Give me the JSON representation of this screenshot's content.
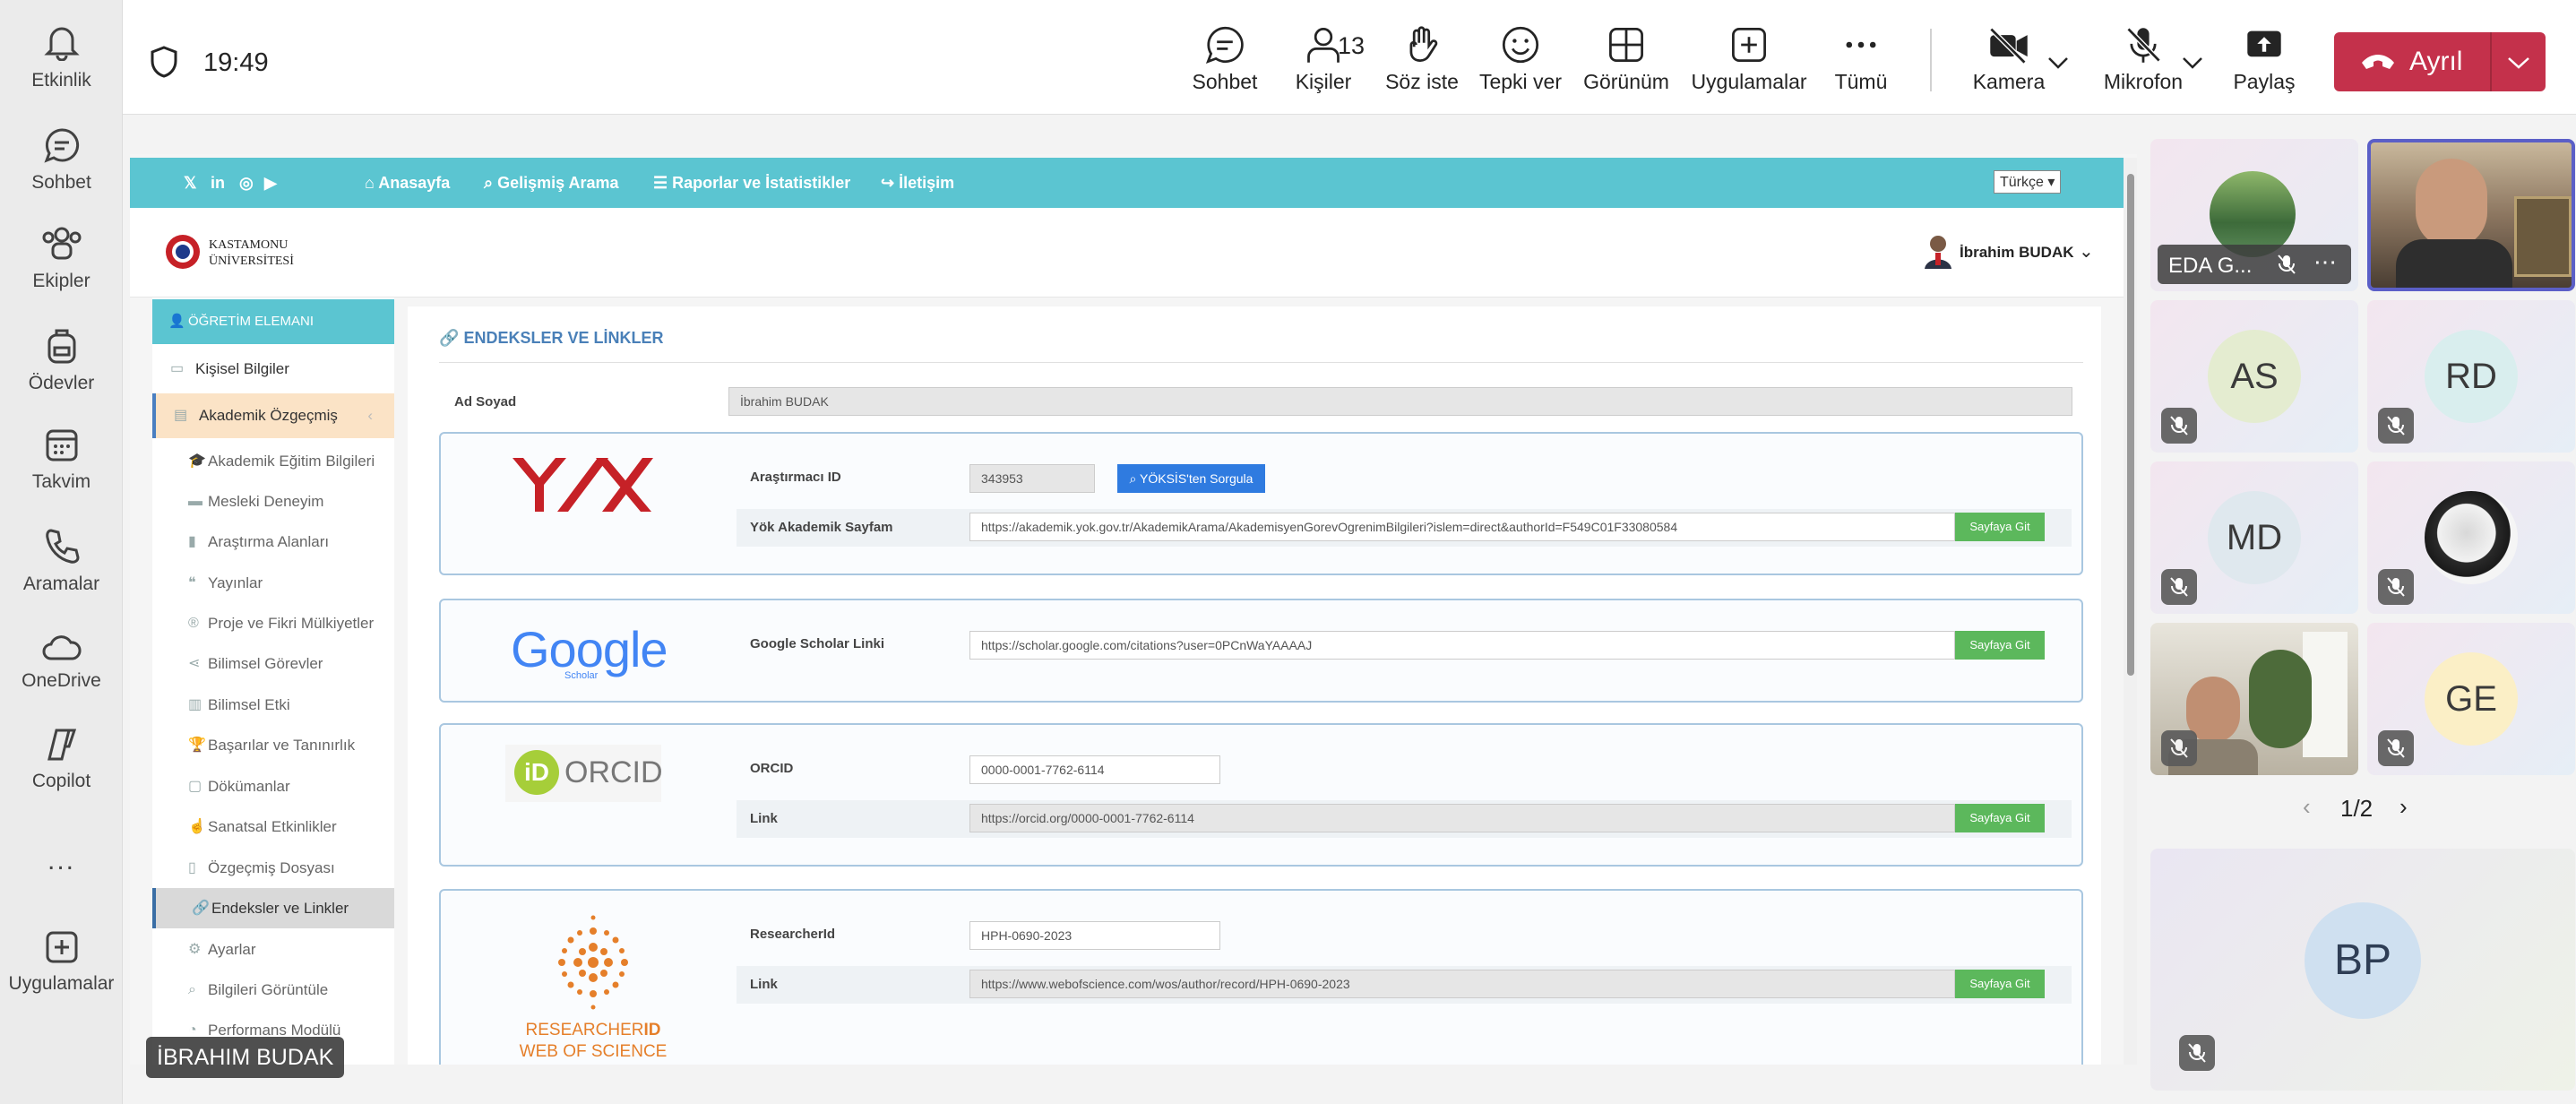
{
  "rail": [
    {
      "label": "Etkinlik",
      "icon": "bell-icon"
    },
    {
      "label": "Sohbet",
      "icon": "chat-icon"
    },
    {
      "label": "Ekipler",
      "icon": "teams-icon"
    },
    {
      "label": "Ödevler",
      "icon": "backpack-icon"
    },
    {
      "label": "Takvim",
      "icon": "calendar-icon"
    },
    {
      "label": "Aramalar",
      "icon": "phone-icon"
    },
    {
      "label": "OneDrive",
      "icon": "cloud-icon"
    },
    {
      "label": "Copilot",
      "icon": "copilot-icon"
    },
    {
      "label": "...",
      "icon": "more-icon"
    },
    {
      "label": "Uygulamalar",
      "icon": "add-apps-icon"
    }
  ],
  "meeting": {
    "time": "19:49",
    "toolbar": {
      "chat": "Sohbet",
      "people": "Kişiler",
      "people_count": "13",
      "raise": "Söz iste",
      "react": "Tepki ver",
      "view": "Görünüm",
      "apps": "Uygulamalar",
      "more": "Tümü",
      "camera": "Kamera",
      "mic": "Mikrofon",
      "share": "Paylaş",
      "leave": "Ayrıl"
    },
    "presenter_name": "İBRAHIM BUDAK"
  },
  "site": {
    "nav": {
      "home": "Anasayfa",
      "search": "Gelişmiş Arama",
      "reports": "Raporlar ve İstatistikler",
      "contact": "İletişim",
      "language": "Türkçe"
    },
    "logo_line1": "KASTAMONU",
    "logo_line2": "ÜNİVERSİTESİ",
    "user": "İbrahim BUDAK",
    "sidebar": {
      "header": "ÖĞRETİM ELEMANI",
      "items": [
        "Kişisel Bilgiler",
        "Akademik Özgeçmiş",
        "Akademik Eğitim Bilgileri",
        "Mesleki Deneyim",
        "Araştırma Alanları",
        "Yayınlar",
        "Proje ve Fikri Mülkiyetler",
        "Bilimsel Görevler",
        "Bilimsel Etki",
        "Başarılar ve Tanınırlık",
        "Dökümanlar",
        "Sanatsal Etkinlikler",
        "Özgeçmiş Dosyası",
        "Endeksler ve Linkler",
        "Ayarlar",
        "Bilgileri Görüntüle",
        "Performans Modülü"
      ]
    },
    "section_title": "ENDEKSLER VE LİNKLER",
    "name_label": "Ad Soyad",
    "name_value": "İbrahim BUDAK",
    "yok": {
      "logo": "YÖK",
      "id_label": "Araştırmacı ID",
      "id_value": "343953",
      "query_button": "YÖKSİS'ten Sorgula",
      "page_label": "Yök Akademik Sayfam",
      "page_value": "https://akademik.yok.gov.tr/AkademikArama/AkademisyenGorevOgrenimBilgileri?islem=direct&authorId=F549C01F33080584",
      "go": "Sayfaya Git"
    },
    "google": {
      "logo": "Google",
      "logo_sub": "Scholar",
      "label": "Google Scholar Linki",
      "value": "https://scholar.google.com/citations?user=0PCnWaYAAAAJ",
      "go": "Sayfaya Git"
    },
    "orcid": {
      "logo": "ORCID",
      "logo_mark": "iD",
      "id_label": "ORCID",
      "id_value": "0000-0001-7762-6114",
      "link_label": "Link",
      "link_value": "https://orcid.org/0000-0001-7762-6114",
      "go": "Sayfaya Git"
    },
    "researcher": {
      "logo_line1": "RESEARCHER",
      "logo_line1b": "ID",
      "logo_line2": "WEB OF SCIENCE",
      "id_label": "ResearcherId",
      "id_value": "HPH-0690-2023",
      "link_label": "Link",
      "link_value": "https://www.webofscience.com/wos/author/record/HPH-0690-2023",
      "go": "Sayfaya Git"
    }
  },
  "gallery": {
    "tiles": [
      {
        "name": "EDA G...",
        "type": "photo"
      },
      {
        "name": "",
        "type": "video-active"
      },
      {
        "initials": "AS",
        "bg": "#e4ecd0"
      },
      {
        "initials": "RD",
        "bg": "#d9eeee"
      },
      {
        "initials": "MD",
        "bg": "#dfe8ee"
      },
      {
        "name": "",
        "type": "photo-bw"
      },
      {
        "name": "",
        "type": "video"
      },
      {
        "initials": "GE",
        "bg": "#fbefc6"
      }
    ],
    "page": "1/2",
    "bottom": {
      "initials": "BP",
      "bg": "#cfe0f0"
    }
  },
  "colors": {
    "leave": "#c4314b",
    "accent": "#5b5fc7",
    "site_nav": "#5bc5d1",
    "go": "#5cb85c",
    "query": "#2f7be0"
  }
}
